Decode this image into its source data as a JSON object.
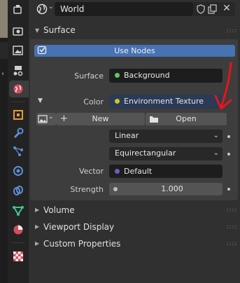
{
  "header": {
    "datablock_name": "World"
  },
  "panel_surface": {
    "title": "Surface",
    "use_nodes_label": "Use Nodes",
    "surface_label": "Surface",
    "surface_value": "Background",
    "color_label": "Color",
    "color_value": "Environment Texture",
    "new_label": "New",
    "open_label": "Open",
    "interpolation_value": "Linear",
    "projection_value": "Equirectangular",
    "vector_label": "Vector",
    "vector_value": "Default",
    "strength_label": "Strength",
    "strength_value": "1.000"
  },
  "collapsed_panels": [
    {
      "title": "Volume"
    },
    {
      "title": "Viewport Display"
    },
    {
      "title": "Custom Properties"
    }
  ],
  "colors": {
    "accent_blue": "#4772b3",
    "socket_green": "#63c763",
    "socket_yellow": "#c7c729",
    "socket_purple": "#6363c7",
    "annotation_red": "#e8141b"
  },
  "icons": {
    "tabs": [
      "tool-icon",
      "render-icon",
      "output-icon",
      "view-layer-icon",
      "scene-icon",
      "world-icon",
      "object-icon",
      "modifier-icon",
      "particles-icon",
      "physics-icon",
      "constraints-icon",
      "data-icon",
      "material-icon",
      "texture-icon"
    ]
  }
}
